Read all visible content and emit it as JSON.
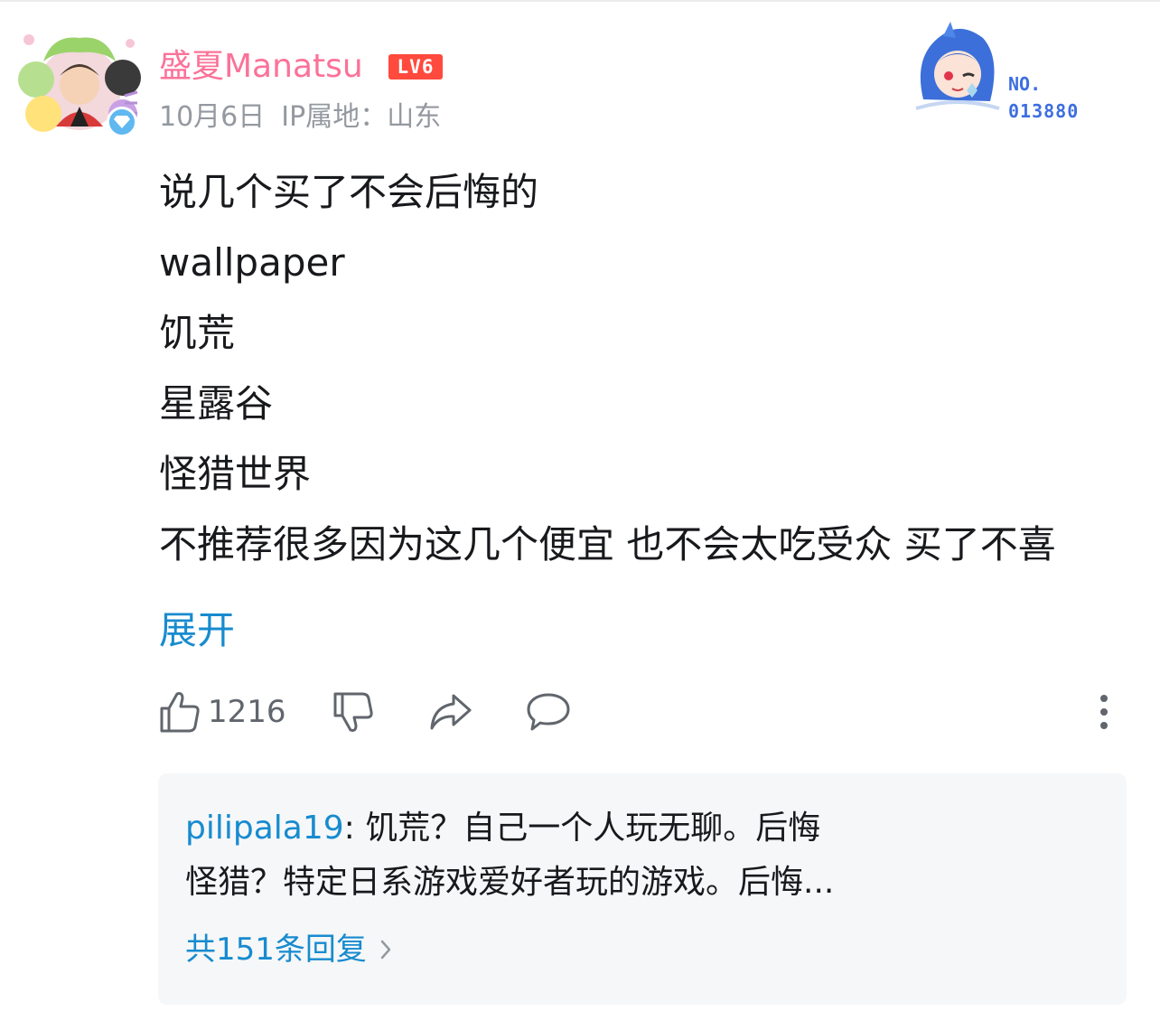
{
  "comment": {
    "username": "盛夏Manatsu",
    "level": "LV6",
    "date": "10月6日",
    "ip_location": "IP属地：山东",
    "lines": [
      "说几个买了不会后悔的",
      "wallpaper",
      "饥荒",
      "星露谷",
      "怪猎世界",
      "不推荐很多因为这几个便宜 也不会太吃受众 买了不喜"
    ],
    "expand_label": "展开",
    "like_count": "1216"
  },
  "fan_badge": {
    "label": "NO.",
    "number": "013880"
  },
  "replies": {
    "preview_user": "pilipala19",
    "preview_line1_text": ": 饥荒？自己一个人玩无聊。后悔",
    "preview_line2_text": "怪猎？特定日系游戏爱好者玩的游戏。后悔...",
    "count_label": "共151条回复"
  },
  "colors": {
    "username": "#fb7299",
    "level_badge": "#ff4a3d",
    "link_blue": "#178bcf",
    "meta_gray": "#9499a0",
    "fan_number": "#3d6ee0",
    "reply_bg": "#f6f7f8"
  },
  "icons": {
    "like": "thumbs-up-icon",
    "dislike": "thumbs-down-icon",
    "share": "share-arrow-icon",
    "reply": "chat-bubble-icon",
    "more": "vertical-dots-icon",
    "chevron": "chevron-right-icon"
  }
}
